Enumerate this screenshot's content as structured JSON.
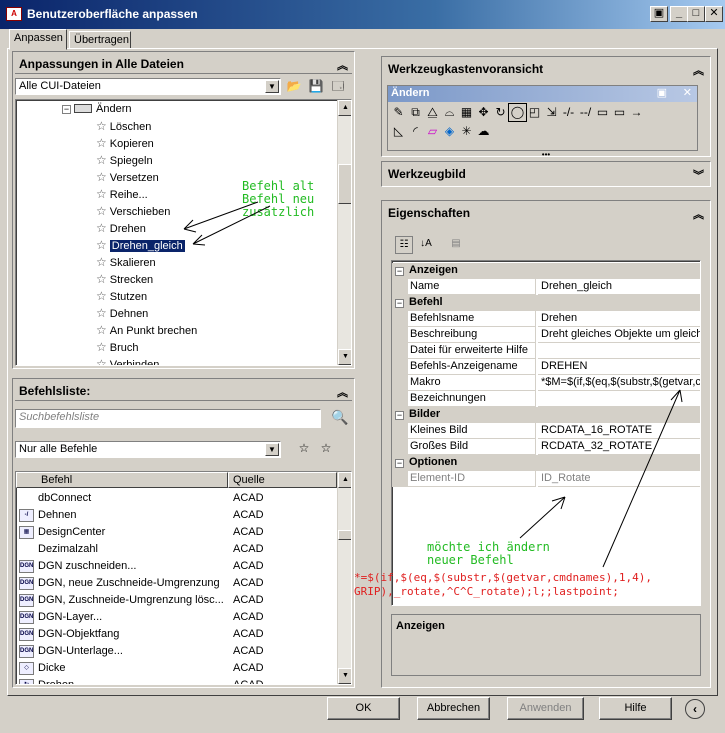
{
  "window": {
    "title": "Benutzeroberfläche anpassen",
    "buttons": [
      "restore-icon",
      "minimize-icon",
      "maximize-icon",
      "close-icon"
    ]
  },
  "tabs": [
    {
      "label": "Anpassen"
    },
    {
      "label": "Übertragen"
    }
  ],
  "left_top": {
    "title": "Anpassungen in Alle Dateien",
    "combo_value": "Alle CUI-Dateien",
    "tree": [
      {
        "label": "Ändern",
        "type": "folder"
      },
      {
        "label": "Löschen"
      },
      {
        "label": "Kopieren"
      },
      {
        "label": "Spiegeln"
      },
      {
        "label": "Versetzen"
      },
      {
        "label": "Reihe..."
      },
      {
        "label": "Verschieben"
      },
      {
        "label": "Drehen"
      },
      {
        "label": "Drehen_gleich",
        "selected": true
      },
      {
        "label": "Skalieren"
      },
      {
        "label": "Strecken"
      },
      {
        "label": "Stutzen"
      },
      {
        "label": "Dehnen"
      },
      {
        "label": "An Punkt brechen"
      },
      {
        "label": "Bruch"
      },
      {
        "label": "Verbinden"
      }
    ]
  },
  "left_bottom": {
    "title": "Befehlsliste:",
    "search_placeholder": "Suchbefehlsliste",
    "filter_value": "Nur alle Befehle",
    "columns": [
      "Befehl",
      "Quelle"
    ],
    "rows": [
      {
        "name": "dbConnect",
        "source": "ACAD",
        "icon": ""
      },
      {
        "name": "Dehnen",
        "source": "ACAD",
        "icon": "extend-icon"
      },
      {
        "name": "DesignCenter",
        "source": "ACAD",
        "icon": "designcenter-icon"
      },
      {
        "name": "Dezimalzahl",
        "source": "ACAD",
        "icon": ""
      },
      {
        "name": "DGN zuschneiden...",
        "source": "ACAD",
        "icon": "dgn-icon"
      },
      {
        "name": "DGN, neue Zuschneide-Umgrenzung",
        "source": "ACAD",
        "icon": "dgn-icon"
      },
      {
        "name": "DGN, Zuschneide-Umgrenzung lösc...",
        "source": "ACAD",
        "icon": "dgn-icon"
      },
      {
        "name": "DGN-Layer...",
        "source": "ACAD",
        "icon": "dgn-icon"
      },
      {
        "name": "DGN-Objektfang",
        "source": "ACAD",
        "icon": "dgn-icon"
      },
      {
        "name": "DGN-Unterlage...",
        "source": "ACAD",
        "icon": "dgn-icon"
      },
      {
        "name": "Dicke",
        "source": "ACAD",
        "icon": "thickness-icon"
      },
      {
        "name": "Drehen",
        "source": "ACAD",
        "icon": "rotate-icon"
      }
    ]
  },
  "right_toolbar": {
    "title": "Werkzeugkastenvoransicht",
    "preview_title": "Ändern"
  },
  "right_image": {
    "title": "Werkzeugbild"
  },
  "right_props": {
    "title": "Eigenschaften",
    "categories": [
      {
        "name": "Anzeigen",
        "rows": [
          {
            "key": "Name",
            "value": "Drehen_gleich"
          }
        ]
      },
      {
        "name": "Befehl",
        "rows": [
          {
            "key": "Befehlsname",
            "value": "Drehen"
          },
          {
            "key": "Beschreibung",
            "value": "Dreht gleiches Objekte um gleiche"
          },
          {
            "key": "Datei für erweiterte Hilfe",
            "value": ""
          },
          {
            "key": "Befehls-Anzeigename",
            "value": "DREHEN"
          },
          {
            "key": "Makro",
            "value": "*$M=$(if,$(eq,$(substr,$(getvar,cm"
          },
          {
            "key": "Bezeichnungen",
            "value": ""
          }
        ]
      },
      {
        "name": "Bilder",
        "rows": [
          {
            "key": "Kleines Bild",
            "value": "RCDATA_16_ROTATE"
          },
          {
            "key": "Großes Bild",
            "value": "RCDATA_32_ROTATE"
          }
        ]
      },
      {
        "name": "Optionen",
        "rows": [
          {
            "key": "Element-ID",
            "value": "ID_Rotate",
            "disabled": true
          }
        ]
      }
    ],
    "desc_title": "Anzeigen"
  },
  "annotations": {
    "tree_note": "Befehl alt\nBefehl neu\nzusätzlich",
    "props_note": "möchte ich ändern\nneuer Befehl",
    "macro_line1": "*=$(if,$(eq,$(substr,$(getvar,cmdnames),1,4),",
    "macro_line2": "GRIP),_rotate,^C^C_rotate);l;;lastpoint;"
  },
  "footer": {
    "ok": "OK",
    "cancel": "Abbrechen",
    "apply": "Anwenden",
    "help": "Hilfe"
  },
  "colors": {
    "selection": "#0a246a",
    "annotation_green": "#22bb22",
    "annotation_red": "#e02020"
  }
}
